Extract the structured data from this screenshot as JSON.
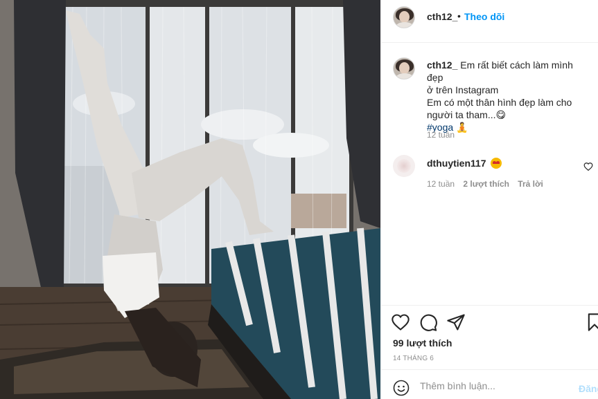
{
  "post": {
    "username": "cth12_",
    "separator": "•",
    "follow_label": "Theo dõi"
  },
  "caption": {
    "username": "cth12_",
    "line1": "Em rất biết cách làm mình đẹp",
    "line2": "ở trên Instagram",
    "line3": "Em có một thân hình đẹp làm cho",
    "line4": "người ta tham...😋",
    "hashtag": "#yoga",
    "hashtag_emoji": "🧘",
    "time": "12 tuần"
  },
  "comments": [
    {
      "username": "dthuytien117",
      "time": "12 tuần",
      "likes": "2 lượt thích",
      "reply_label": "Trả lời"
    }
  ],
  "actions": {
    "icons": [
      "heart-icon",
      "comment-icon",
      "share-icon",
      "bookmark-icon"
    ],
    "likes": "99 lượt thích",
    "date": "14 THÁNG 6"
  },
  "add_comment": {
    "placeholder": "Thêm bình luận...",
    "post_label": "Đăng"
  },
  "colors": {
    "accent": "#0095f6",
    "hashtag": "#00376b",
    "muted": "#8e8e8e",
    "text": "#262626",
    "post_disabled": "#b2dffc"
  }
}
